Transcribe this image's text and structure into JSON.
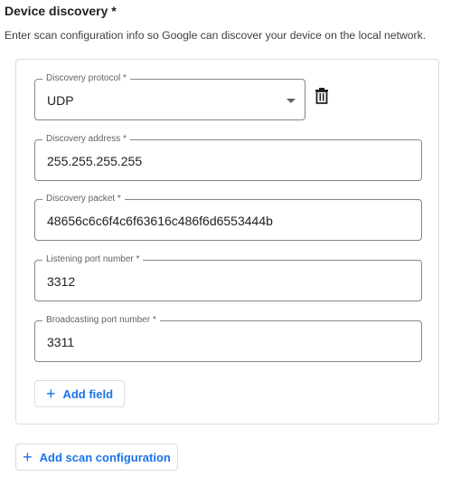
{
  "section": {
    "title": "Device discovery *",
    "description": "Enter scan configuration info so Google can discover your device on the local network."
  },
  "config": {
    "protocol": {
      "label": "Discovery protocol *",
      "value": "UDP",
      "icon": "chevron-down-icon"
    },
    "delete_icon": "trash-icon",
    "address": {
      "label": "Discovery address *",
      "value": "255.255.255.255"
    },
    "packet": {
      "label": "Discovery packet *",
      "value": "48656c6c6f4c6f63616c486f6d6553444b"
    },
    "listening_port": {
      "label": "Listening port number *",
      "value": "3312"
    },
    "broadcasting_port": {
      "label": "Broadcasting port number *",
      "value": "3311"
    },
    "add_field": {
      "icon": "+",
      "label": "Add field"
    }
  },
  "add_scan_config": {
    "icon": "+",
    "label": "Add scan configuration"
  },
  "colors": {
    "accent": "#1a73e8",
    "border": "#dadce0",
    "outline": "#80868b",
    "label": "#5f6368"
  }
}
